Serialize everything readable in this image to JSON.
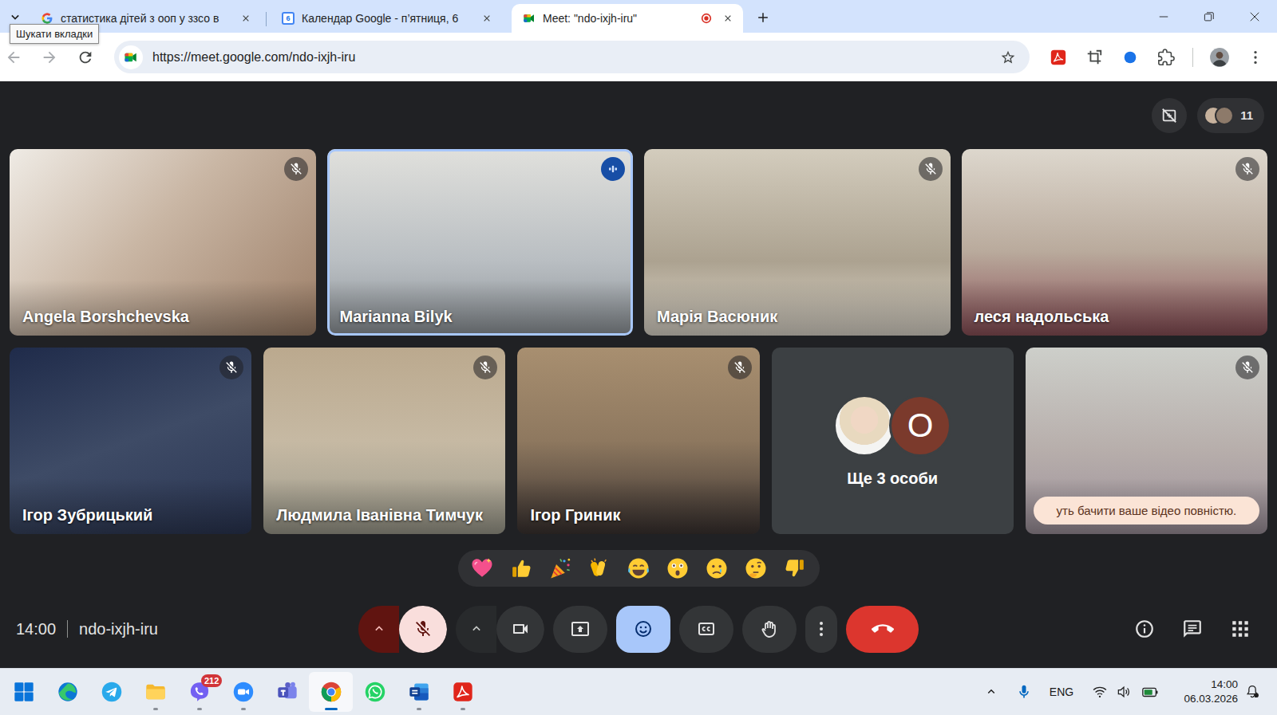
{
  "browser": {
    "tab_search_tooltip": "Шукати вкладки",
    "tabs": [
      {
        "label": "статистика дітей з ооп у ззсо в",
        "selected": false,
        "recording": false,
        "kind": "google"
      },
      {
        "label": "Календар Google - п’ятниця, 6",
        "selected": false,
        "recording": false,
        "kind": "calendar",
        "favicon_text": "6"
      },
      {
        "label": "Meet: \"ndo-ixjh-iru\"",
        "selected": true,
        "recording": true,
        "kind": "meet"
      }
    ],
    "nav": [
      {
        "kind": "back",
        "disabled": true
      },
      {
        "kind": "forward",
        "disabled": true
      },
      {
        "kind": "reload",
        "disabled": false
      }
    ],
    "url": "https://meet.google.com/ndo-ixjh-iru",
    "bookmarked": false,
    "extensions": [
      {
        "kind": "acrobat"
      },
      {
        "kind": "screenshot"
      },
      {
        "kind": "blue-circle"
      },
      {
        "kind": "puzzle"
      }
    ]
  },
  "meet": {
    "participant_count": "11",
    "tiles": [
      {
        "kind": "video",
        "name": "Angela Borshchevska",
        "muted": true,
        "speaking": false
      },
      {
        "kind": "video",
        "name": "Marianna Bilyk",
        "muted": false,
        "speaking": true
      },
      {
        "kind": "video",
        "name": "Марія Васюник",
        "muted": true,
        "speaking": false
      },
      {
        "kind": "video",
        "name": "леся надольська",
        "muted": true,
        "speaking": false
      },
      {
        "kind": "video",
        "name": "Ігор Зубрицький",
        "muted": true,
        "speaking": false
      },
      {
        "kind": "video",
        "name": "Людмила Іванівна Тимчук",
        "muted": true,
        "speaking": false
      },
      {
        "kind": "video",
        "name": "Ігор Гриник",
        "muted": true,
        "speaking": false
      },
      {
        "kind": "more",
        "label": "Ще 3 особи",
        "avatars": [
          {
            "kind": "photo"
          },
          {
            "kind": "letter",
            "letter": "О",
            "color": "#7b3a2c"
          }
        ]
      },
      {
        "kind": "self",
        "muted": true,
        "speaking": false,
        "toast": "уть бачити ваше відео повністю."
      }
    ],
    "reactions": [
      {
        "kind": "sparkling-heart"
      },
      {
        "kind": "thumbs-up"
      },
      {
        "kind": "party-popper"
      },
      {
        "kind": "clapping"
      },
      {
        "kind": "tears-of-joy"
      },
      {
        "kind": "astonished"
      },
      {
        "kind": "crying"
      },
      {
        "kind": "thinking"
      },
      {
        "kind": "thumbs-down"
      }
    ],
    "meeting_time": "14:00",
    "meeting_code": "ndo-ixjh-iru",
    "controls": [
      {
        "kind": "mic",
        "on": false
      },
      {
        "kind": "camera",
        "on": true
      },
      {
        "kind": "present",
        "on": false
      },
      {
        "kind": "reactions",
        "on": true
      },
      {
        "kind": "captions",
        "on": false
      },
      {
        "kind": "hand",
        "on": false
      },
      {
        "kind": "more",
        "on": false
      },
      {
        "kind": "leave",
        "on": false
      }
    ],
    "side_buttons": [
      {
        "kind": "info"
      },
      {
        "kind": "chat"
      },
      {
        "kind": "activities"
      }
    ]
  },
  "taskbar": {
    "apps": [
      {
        "kind": "start",
        "running": false,
        "selected": false
      },
      {
        "kind": "edge",
        "running": false,
        "selected": false
      },
      {
        "kind": "telegram",
        "running": false,
        "selected": false
      },
      {
        "kind": "explorer",
        "running": true,
        "selected": false
      },
      {
        "kind": "viber",
        "running": true,
        "selected": false,
        "badge": "212"
      },
      {
        "kind": "zoom",
        "running": true,
        "selected": false
      },
      {
        "kind": "teams",
        "running": false,
        "selected": false
      },
      {
        "kind": "chrome",
        "running": true,
        "selected": true
      },
      {
        "kind": "whatsapp",
        "running": false,
        "selected": false
      },
      {
        "kind": "word",
        "running": true,
        "selected": false
      },
      {
        "kind": "acrobat",
        "running": true,
        "selected": false
      }
    ],
    "tray": {
      "mic_in_use": true,
      "language": "ENG",
      "time": "14:00",
      "date": "06.03.2026"
    }
  }
}
